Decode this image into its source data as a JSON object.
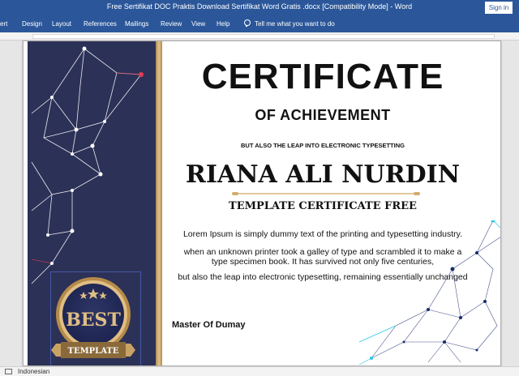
{
  "window": {
    "title": "Free Sertifikat DOC Praktis Download Sertifikat Word Gratis .docx [Compatibility Mode]  -  Word",
    "sign_in": "Sign in"
  },
  "ribbon": {
    "tabs": [
      "sert",
      "Design",
      "Layout",
      "References",
      "Mailings",
      "Review",
      "View",
      "Help"
    ],
    "tell_me": "Tell me what you want to do"
  },
  "certificate": {
    "title": "CERTIFICATE",
    "subtitle": "OF ACHIEVEMENT",
    "tagline": "BUT ALSO THE LEAP INTO ELECTRONIC TYPESETTING",
    "name": "RIANA ALI NURDIN",
    "template_line": "TEMPLATE CERTIFICATE FREE",
    "body": [
      "Lorem Ipsum is simply dummy text of the printing and typesetting industry.",
      "when an unknown printer took a galley of type and scrambled it to make a",
      "type specimen book. It has survived not only five centuries,",
      "but also the leap into electronic typesetting, remaining essentially unchanged"
    ],
    "signer": "Master Of Dumay",
    "badge": {
      "word": "BEST",
      "ribbon": "TEMPLATE"
    }
  },
  "status": {
    "language": "Indonesian"
  },
  "colors": {
    "titlebar": "#2b579a",
    "band": "#2c3157",
    "gold": "#d2ad6b",
    "network_left": "#ffffff",
    "network_accent": "#e63a55",
    "network_right": "#1a2b6e",
    "network_cyan": "#26c6e8"
  }
}
